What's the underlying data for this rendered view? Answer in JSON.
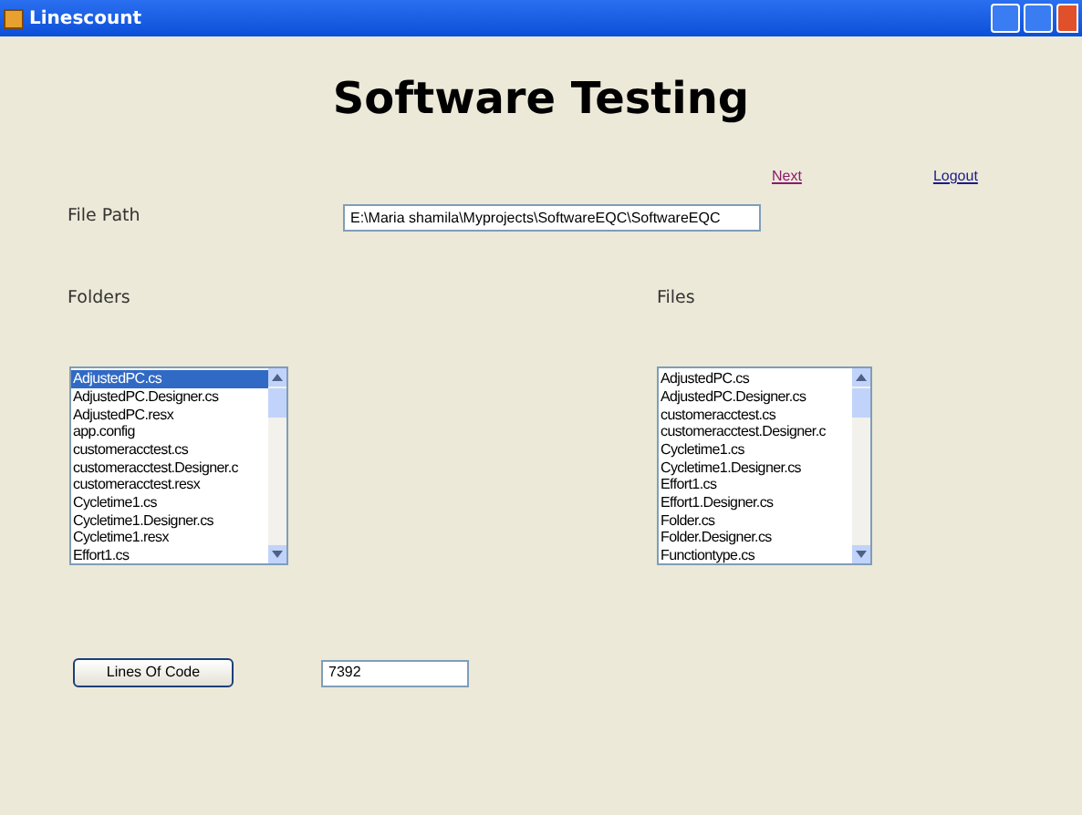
{
  "window": {
    "title": "Linescount"
  },
  "heading": "Software Testing",
  "links": [
    {
      "label": "Next",
      "visited": true
    },
    {
      "label": "Logout",
      "visited": false
    }
  ],
  "file_path": {
    "label": "File Path",
    "value": "E:\\Maria shamila\\Myprojects\\SoftwareEQC\\SoftwareEQC"
  },
  "folders": {
    "label": "Folders",
    "items": [
      {
        "label": "AdjustedPC.cs",
        "selected": true
      },
      {
        "label": "AdjustedPC.Designer.cs",
        "selected": false
      },
      {
        "label": "AdjustedPC.resx",
        "selected": false
      },
      {
        "label": "app.config",
        "selected": false
      },
      {
        "label": "customeracctest.cs",
        "selected": false
      },
      {
        "label": "customeracctest.Designer.c",
        "selected": false
      },
      {
        "label": "customeracctest.resx",
        "selected": false
      },
      {
        "label": "Cycletime1.cs",
        "selected": false
      },
      {
        "label": "Cycletime1.Designer.cs",
        "selected": false
      },
      {
        "label": "Cycletime1.resx",
        "selected": false
      },
      {
        "label": "Effort1.cs",
        "selected": false
      }
    ]
  },
  "files": {
    "label": "Files",
    "items": [
      {
        "label": "AdjustedPC.cs",
        "selected": false
      },
      {
        "label": "AdjustedPC.Designer.cs",
        "selected": false
      },
      {
        "label": "customeracctest.cs",
        "selected": false
      },
      {
        "label": "customeracctest.Designer.c",
        "selected": false
      },
      {
        "label": "Cycletime1.cs",
        "selected": false
      },
      {
        "label": "Cycletime1.Designer.cs",
        "selected": false
      },
      {
        "label": "Effort1.cs",
        "selected": false
      },
      {
        "label": "Effort1.Designer.cs",
        "selected": false
      },
      {
        "label": "Folder.cs",
        "selected": false
      },
      {
        "label": "Folder.Designer.cs",
        "selected": false
      },
      {
        "label": "Functiontype.cs",
        "selected": false
      }
    ]
  },
  "lines_button": "Lines Of Code",
  "lines_result": "7392"
}
